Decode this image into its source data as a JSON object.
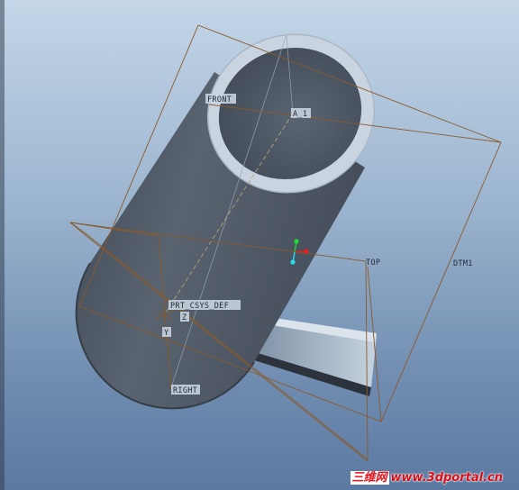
{
  "viewport": {
    "background_top": "#c4d6e8",
    "background_bottom": "#5c79a1",
    "model_color": "#4e5865",
    "rim_color": "#c9d4e0",
    "datum_color": "#8a5a2c"
  },
  "datum_labels": {
    "front": "FRONT",
    "axis": "A_1",
    "top": "TOP",
    "dtm1": "DTM1",
    "csys": "PRT_CSYS_DEF",
    "csys_axis_z": "Z",
    "csys_axis_y": "Y",
    "right": "RIGHT"
  },
  "watermark": {
    "chinese": "三维网",
    "url": "www.3dportal.cn"
  }
}
